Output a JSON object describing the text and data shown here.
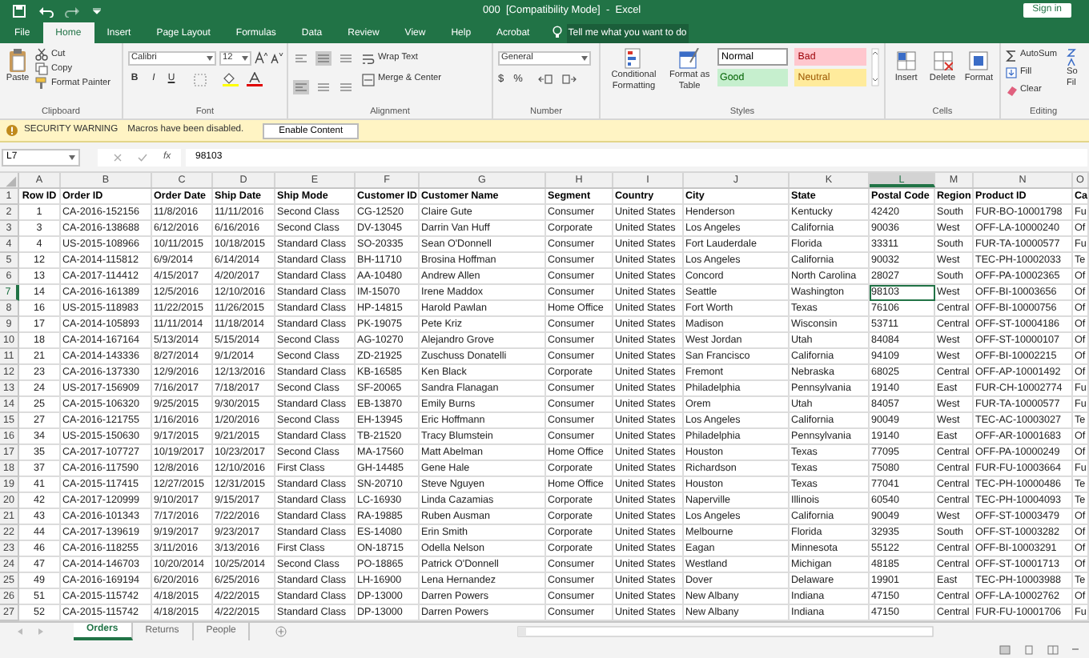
{
  "window": {
    "title": "000  [Compatibility Mode]  -  Excel",
    "sign_in": "Sign in"
  },
  "ribbon_tabs": [
    {
      "label": "File",
      "selected": false
    },
    {
      "label": "Home",
      "selected": true
    },
    {
      "label": "Insert",
      "selected": false
    },
    {
      "label": "Page Layout",
      "selected": false
    },
    {
      "label": "Formulas",
      "selected": false
    },
    {
      "label": "Data",
      "selected": false
    },
    {
      "label": "Review",
      "selected": false
    },
    {
      "label": "View",
      "selected": false
    },
    {
      "label": "Help",
      "selected": false
    },
    {
      "label": "Acrobat",
      "selected": false
    }
  ],
  "tell_me": "Tell me what you want to do",
  "ribbon": {
    "clipboard": {
      "label": "Clipboard",
      "paste": "Paste",
      "cut": "Cut",
      "copy": "Copy",
      "format_painter": "Format Painter"
    },
    "font": {
      "label": "Font",
      "font_name": "Calibri",
      "font_size": "12",
      "bold": "B",
      "italic": "I",
      "underline": "U"
    },
    "alignment": {
      "label": "Alignment",
      "wrap_text": "Wrap Text",
      "merge": "Merge & Center"
    },
    "number": {
      "label": "Number",
      "format": "General",
      "currency": "$",
      "percent": "%"
    },
    "styles": {
      "label": "Styles",
      "conditional": "Conditional Formatting",
      "format_table": "Format as Table",
      "cell_styles": [
        {
          "label": "Normal",
          "kind": "normal"
        },
        {
          "label": "Bad",
          "kind": "bad"
        },
        {
          "label": "Good",
          "kind": "good"
        },
        {
          "label": "Neutral",
          "kind": "neutral"
        }
      ]
    },
    "cells": {
      "label": "Cells",
      "insert": "Insert",
      "delete": "Delete",
      "format": "Format"
    },
    "editing": {
      "label": "Editing",
      "autosum": "AutoSum",
      "fill": "Fill",
      "clear": "Clear",
      "sort_partial": "So",
      "filter_partial": "Fil"
    }
  },
  "security_warning": {
    "title": "SECURITY WARNING",
    "message": "Macros have been disabled.",
    "button": "Enable Content"
  },
  "formula_bar": {
    "name_box": "L7",
    "function_label": "fx",
    "value": "98103"
  },
  "columns": [
    {
      "letter": "A",
      "selected": false
    },
    {
      "letter": "B",
      "selected": false
    },
    {
      "letter": "C",
      "selected": false
    },
    {
      "letter": "D",
      "selected": false
    },
    {
      "letter": "E",
      "selected": false
    },
    {
      "letter": "F",
      "selected": false
    },
    {
      "letter": "G",
      "selected": false
    },
    {
      "letter": "H",
      "selected": false
    },
    {
      "letter": "I",
      "selected": false
    },
    {
      "letter": "J",
      "selected": false
    },
    {
      "letter": "K",
      "selected": false
    },
    {
      "letter": "L",
      "selected": true
    },
    {
      "letter": "M",
      "selected": false
    },
    {
      "letter": "N",
      "selected": false
    },
    {
      "letter": "O",
      "selected": false
    }
  ],
  "rows": [
    {
      "number": "1",
      "selected": false,
      "cells": [
        "Row ID",
        "Order ID",
        "Order Date",
        "Ship Date",
        "Ship Mode",
        "Customer ID",
        "Customer Name",
        "Segment",
        "Country",
        "City",
        "State",
        "Postal Code",
        "Region",
        "Product ID",
        "Ca"
      ]
    },
    {
      "number": "2",
      "selected": false,
      "cells": [
        "1",
        "CA-2016-152156",
        "11/8/2016",
        "11/11/2016",
        "Second Class",
        "CG-12520",
        "Claire Gute",
        "Consumer",
        "United States",
        "Henderson",
        "Kentucky",
        "42420",
        "South",
        "FUR-BO-10001798",
        "Fu"
      ]
    },
    {
      "number": "3",
      "selected": false,
      "cells": [
        "3",
        "CA-2016-138688",
        "6/12/2016",
        "6/16/2016",
        "Second Class",
        "DV-13045",
        "Darrin Van Huff",
        "Corporate",
        "United States",
        "Los Angeles",
        "California",
        "90036",
        "West",
        "OFF-LA-10000240",
        "Of"
      ]
    },
    {
      "number": "4",
      "selected": false,
      "cells": [
        "4",
        "US-2015-108966",
        "10/11/2015",
        "10/18/2015",
        "Standard Class",
        "SO-20335",
        "Sean O'Donnell",
        "Consumer",
        "United States",
        "Fort Lauderdale",
        "Florida",
        "33311",
        "South",
        "FUR-TA-10000577",
        "Fu"
      ]
    },
    {
      "number": "5",
      "selected": false,
      "cells": [
        "12",
        "CA-2014-115812",
        "6/9/2014",
        "6/14/2014",
        "Standard Class",
        "BH-11710",
        "Brosina Hoffman",
        "Consumer",
        "United States",
        "Los Angeles",
        "California",
        "90032",
        "West",
        "TEC-PH-10002033",
        "Te"
      ]
    },
    {
      "number": "6",
      "selected": false,
      "cells": [
        "13",
        "CA-2017-114412",
        "4/15/2017",
        "4/20/2017",
        "Standard Class",
        "AA-10480",
        "Andrew Allen",
        "Consumer",
        "United States",
        "Concord",
        "North Carolina",
        "28027",
        "South",
        "OFF-PA-10002365",
        "Of"
      ]
    },
    {
      "number": "7",
      "selected": true,
      "cells": [
        "14",
        "CA-2016-161389",
        "12/5/2016",
        "12/10/2016",
        "Standard Class",
        "IM-15070",
        "Irene Maddox",
        "Consumer",
        "United States",
        "Seattle",
        "Washington",
        "98103",
        "West",
        "OFF-BI-10003656",
        "Of"
      ]
    },
    {
      "number": "8",
      "selected": false,
      "cells": [
        "16",
        "US-2015-118983",
        "11/22/2015",
        "11/26/2015",
        "Standard Class",
        "HP-14815",
        "Harold Pawlan",
        "Home Office",
        "United States",
        "Fort Worth",
        "Texas",
        "76106",
        "Central",
        "OFF-BI-10000756",
        "Of"
      ]
    },
    {
      "number": "9",
      "selected": false,
      "cells": [
        "17",
        "CA-2014-105893",
        "11/11/2014",
        "11/18/2014",
        "Standard Class",
        "PK-19075",
        "Pete Kriz",
        "Consumer",
        "United States",
        "Madison",
        "Wisconsin",
        "53711",
        "Central",
        "OFF-ST-10004186",
        "Of"
      ]
    },
    {
      "number": "10",
      "selected": false,
      "cells": [
        "18",
        "CA-2014-167164",
        "5/13/2014",
        "5/15/2014",
        "Second Class",
        "AG-10270",
        "Alejandro Grove",
        "Consumer",
        "United States",
        "West Jordan",
        "Utah",
        "84084",
        "West",
        "OFF-ST-10000107",
        "Of"
      ]
    },
    {
      "number": "11",
      "selected": false,
      "cells": [
        "21",
        "CA-2014-143336",
        "8/27/2014",
        "9/1/2014",
        "Second Class",
        "ZD-21925",
        "Zuschuss Donatelli",
        "Consumer",
        "United States",
        "San Francisco",
        "California",
        "94109",
        "West",
        "OFF-BI-10002215",
        "Of"
      ]
    },
    {
      "number": "12",
      "selected": false,
      "cells": [
        "23",
        "CA-2016-137330",
        "12/9/2016",
        "12/13/2016",
        "Standard Class",
        "KB-16585",
        "Ken Black",
        "Corporate",
        "United States",
        "Fremont",
        "Nebraska",
        "68025",
        "Central",
        "OFF-AP-10001492",
        "Of"
      ]
    },
    {
      "number": "13",
      "selected": false,
      "cells": [
        "24",
        "US-2017-156909",
        "7/16/2017",
        "7/18/2017",
        "Second Class",
        "SF-20065",
        "Sandra Flanagan",
        "Consumer",
        "United States",
        "Philadelphia",
        "Pennsylvania",
        "19140",
        "East",
        "FUR-CH-10002774",
        "Fu"
      ]
    },
    {
      "number": "14",
      "selected": false,
      "cells": [
        "25",
        "CA-2015-106320",
        "9/25/2015",
        "9/30/2015",
        "Standard Class",
        "EB-13870",
        "Emily Burns",
        "Consumer",
        "United States",
        "Orem",
        "Utah",
        "84057",
        "West",
        "FUR-TA-10000577",
        "Fu"
      ]
    },
    {
      "number": "15",
      "selected": false,
      "cells": [
        "27",
        "CA-2016-121755",
        "1/16/2016",
        "1/20/2016",
        "Second Class",
        "EH-13945",
        "Eric Hoffmann",
        "Consumer",
        "United States",
        "Los Angeles",
        "California",
        "90049",
        "West",
        "TEC-AC-10003027",
        "Te"
      ]
    },
    {
      "number": "16",
      "selected": false,
      "cells": [
        "34",
        "US-2015-150630",
        "9/17/2015",
        "9/21/2015",
        "Standard Class",
        "TB-21520",
        "Tracy Blumstein",
        "Consumer",
        "United States",
        "Philadelphia",
        "Pennsylvania",
        "19140",
        "East",
        "OFF-AR-10001683",
        "Of"
      ]
    },
    {
      "number": "17",
      "selected": false,
      "cells": [
        "35",
        "CA-2017-107727",
        "10/19/2017",
        "10/23/2017",
        "Second Class",
        "MA-17560",
        "Matt Abelman",
        "Home Office",
        "United States",
        "Houston",
        "Texas",
        "77095",
        "Central",
        "OFF-PA-10000249",
        "Of"
      ]
    },
    {
      "number": "18",
      "selected": false,
      "cells": [
        "37",
        "CA-2016-117590",
        "12/8/2016",
        "12/10/2016",
        "First Class",
        "GH-14485",
        "Gene Hale",
        "Corporate",
        "United States",
        "Richardson",
        "Texas",
        "75080",
        "Central",
        "FUR-FU-10003664",
        "Fu"
      ]
    },
    {
      "number": "19",
      "selected": false,
      "cells": [
        "41",
        "CA-2015-117415",
        "12/27/2015",
        "12/31/2015",
        "Standard Class",
        "SN-20710",
        "Steve Nguyen",
        "Home Office",
        "United States",
        "Houston",
        "Texas",
        "77041",
        "Central",
        "TEC-PH-10000486",
        "Te"
      ]
    },
    {
      "number": "20",
      "selected": false,
      "cells": [
        "42",
        "CA-2017-120999",
        "9/10/2017",
        "9/15/2017",
        "Standard Class",
        "LC-16930",
        "Linda Cazamias",
        "Corporate",
        "United States",
        "Naperville",
        "Illinois",
        "60540",
        "Central",
        "TEC-PH-10004093",
        "Te"
      ]
    },
    {
      "number": "21",
      "selected": false,
      "cells": [
        "43",
        "CA-2016-101343",
        "7/17/2016",
        "7/22/2016",
        "Standard Class",
        "RA-19885",
        "Ruben Ausman",
        "Corporate",
        "United States",
        "Los Angeles",
        "California",
        "90049",
        "West",
        "OFF-ST-10003479",
        "Of"
      ]
    },
    {
      "number": "22",
      "selected": false,
      "cells": [
        "44",
        "CA-2017-139619",
        "9/19/2017",
        "9/23/2017",
        "Standard Class",
        "ES-14080",
        "Erin Smith",
        "Corporate",
        "United States",
        "Melbourne",
        "Florida",
        "32935",
        "South",
        "OFF-ST-10003282",
        "Of"
      ]
    },
    {
      "number": "23",
      "selected": false,
      "cells": [
        "46",
        "CA-2016-118255",
        "3/11/2016",
        "3/13/2016",
        "First Class",
        "ON-18715",
        "Odella Nelson",
        "Corporate",
        "United States",
        "Eagan",
        "Minnesota",
        "55122",
        "Central",
        "OFF-BI-10003291",
        "Of"
      ]
    },
    {
      "number": "24",
      "selected": false,
      "cells": [
        "47",
        "CA-2014-146703",
        "10/20/2014",
        "10/25/2014",
        "Second Class",
        "PO-18865",
        "Patrick O'Donnell",
        "Consumer",
        "United States",
        "Westland",
        "Michigan",
        "48185",
        "Central",
        "OFF-ST-10001713",
        "Of"
      ]
    },
    {
      "number": "25",
      "selected": false,
      "cells": [
        "49",
        "CA-2016-169194",
        "6/20/2016",
        "6/25/2016",
        "Standard Class",
        "LH-16900",
        "Lena Hernandez",
        "Consumer",
        "United States",
        "Dover",
        "Delaware",
        "19901",
        "East",
        "TEC-PH-10003988",
        "Te"
      ]
    },
    {
      "number": "26",
      "selected": false,
      "cells": [
        "51",
        "CA-2015-115742",
        "4/18/2015",
        "4/22/2015",
        "Standard Class",
        "DP-13000",
        "Darren Powers",
        "Consumer",
        "United States",
        "New Albany",
        "Indiana",
        "47150",
        "Central",
        "OFF-LA-10002762",
        "Of"
      ]
    },
    {
      "number": "27",
      "selected": false,
      "cells": [
        "52",
        "CA-2015-115742",
        "4/18/2015",
        "4/22/2015",
        "Standard Class",
        "DP-13000",
        "Darren Powers",
        "Consumer",
        "United States",
        "New Albany",
        "Indiana",
        "47150",
        "Central",
        "FUR-FU-10001706",
        "Fu"
      ]
    }
  ],
  "sheet_tabs": [
    {
      "label": "Orders",
      "selected": true
    },
    {
      "label": "Returns",
      "selected": false
    },
    {
      "label": "People",
      "selected": false
    }
  ]
}
